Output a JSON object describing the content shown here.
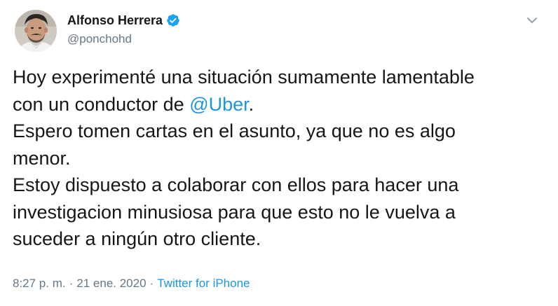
{
  "author": {
    "display_name": "Alfonso Herrera",
    "handle": "@ponchohd",
    "verified": true
  },
  "menu": {
    "icon": "chevron-down-icon"
  },
  "tweet": {
    "line1": "Hoy experimenté una situación sumamente lamentable",
    "line2_before": "con un conductor de ",
    "line2_mention": "@Uber",
    "line2_after": ".",
    "line3": "Espero tomen cartas en el asunto, ya que no es algo",
    "line4": "menor.",
    "line5": "Estoy dispuesto a colaborar con ellos para hacer una",
    "line6": "investigacion minusiosa para que esto no le vuelva a",
    "line7": "suceder a ningún otro cliente."
  },
  "meta": {
    "time": "8:27 p. m.",
    "separator1": "·",
    "date": "21 ene. 2020",
    "separator2": "·",
    "source": "Twitter for iPhone"
  },
  "colors": {
    "link": "#1b95e0",
    "secondary_text": "#657786",
    "primary_text": "#14171a",
    "verified_badge": "#1da1f2"
  }
}
